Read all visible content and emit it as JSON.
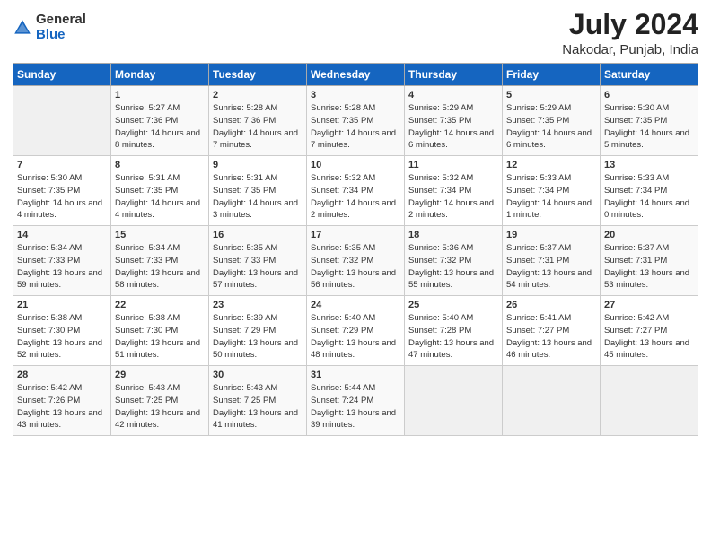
{
  "header": {
    "logo_general": "General",
    "logo_blue": "Blue",
    "title": "July 2024",
    "location": "Nakodar, Punjab, India"
  },
  "calendar": {
    "days_of_week": [
      "Sunday",
      "Monday",
      "Tuesday",
      "Wednesday",
      "Thursday",
      "Friday",
      "Saturday"
    ],
    "weeks": [
      [
        {
          "day": "",
          "sunrise": "",
          "sunset": "",
          "daylight": ""
        },
        {
          "day": "1",
          "sunrise": "Sunrise: 5:27 AM",
          "sunset": "Sunset: 7:36 PM",
          "daylight": "Daylight: 14 hours and 8 minutes."
        },
        {
          "day": "2",
          "sunrise": "Sunrise: 5:28 AM",
          "sunset": "Sunset: 7:36 PM",
          "daylight": "Daylight: 14 hours and 7 minutes."
        },
        {
          "day": "3",
          "sunrise": "Sunrise: 5:28 AM",
          "sunset": "Sunset: 7:35 PM",
          "daylight": "Daylight: 14 hours and 7 minutes."
        },
        {
          "day": "4",
          "sunrise": "Sunrise: 5:29 AM",
          "sunset": "Sunset: 7:35 PM",
          "daylight": "Daylight: 14 hours and 6 minutes."
        },
        {
          "day": "5",
          "sunrise": "Sunrise: 5:29 AM",
          "sunset": "Sunset: 7:35 PM",
          "daylight": "Daylight: 14 hours and 6 minutes."
        },
        {
          "day": "6",
          "sunrise": "Sunrise: 5:30 AM",
          "sunset": "Sunset: 7:35 PM",
          "daylight": "Daylight: 14 hours and 5 minutes."
        }
      ],
      [
        {
          "day": "7",
          "sunrise": "Sunrise: 5:30 AM",
          "sunset": "Sunset: 7:35 PM",
          "daylight": "Daylight: 14 hours and 4 minutes."
        },
        {
          "day": "8",
          "sunrise": "Sunrise: 5:31 AM",
          "sunset": "Sunset: 7:35 PM",
          "daylight": "Daylight: 14 hours and 4 minutes."
        },
        {
          "day": "9",
          "sunrise": "Sunrise: 5:31 AM",
          "sunset": "Sunset: 7:35 PM",
          "daylight": "Daylight: 14 hours and 3 minutes."
        },
        {
          "day": "10",
          "sunrise": "Sunrise: 5:32 AM",
          "sunset": "Sunset: 7:34 PM",
          "daylight": "Daylight: 14 hours and 2 minutes."
        },
        {
          "day": "11",
          "sunrise": "Sunrise: 5:32 AM",
          "sunset": "Sunset: 7:34 PM",
          "daylight": "Daylight: 14 hours and 2 minutes."
        },
        {
          "day": "12",
          "sunrise": "Sunrise: 5:33 AM",
          "sunset": "Sunset: 7:34 PM",
          "daylight": "Daylight: 14 hours and 1 minute."
        },
        {
          "day": "13",
          "sunrise": "Sunrise: 5:33 AM",
          "sunset": "Sunset: 7:34 PM",
          "daylight": "Daylight: 14 hours and 0 minutes."
        }
      ],
      [
        {
          "day": "14",
          "sunrise": "Sunrise: 5:34 AM",
          "sunset": "Sunset: 7:33 PM",
          "daylight": "Daylight: 13 hours and 59 minutes."
        },
        {
          "day": "15",
          "sunrise": "Sunrise: 5:34 AM",
          "sunset": "Sunset: 7:33 PM",
          "daylight": "Daylight: 13 hours and 58 minutes."
        },
        {
          "day": "16",
          "sunrise": "Sunrise: 5:35 AM",
          "sunset": "Sunset: 7:33 PM",
          "daylight": "Daylight: 13 hours and 57 minutes."
        },
        {
          "day": "17",
          "sunrise": "Sunrise: 5:35 AM",
          "sunset": "Sunset: 7:32 PM",
          "daylight": "Daylight: 13 hours and 56 minutes."
        },
        {
          "day": "18",
          "sunrise": "Sunrise: 5:36 AM",
          "sunset": "Sunset: 7:32 PM",
          "daylight": "Daylight: 13 hours and 55 minutes."
        },
        {
          "day": "19",
          "sunrise": "Sunrise: 5:37 AM",
          "sunset": "Sunset: 7:31 PM",
          "daylight": "Daylight: 13 hours and 54 minutes."
        },
        {
          "day": "20",
          "sunrise": "Sunrise: 5:37 AM",
          "sunset": "Sunset: 7:31 PM",
          "daylight": "Daylight: 13 hours and 53 minutes."
        }
      ],
      [
        {
          "day": "21",
          "sunrise": "Sunrise: 5:38 AM",
          "sunset": "Sunset: 7:30 PM",
          "daylight": "Daylight: 13 hours and 52 minutes."
        },
        {
          "day": "22",
          "sunrise": "Sunrise: 5:38 AM",
          "sunset": "Sunset: 7:30 PM",
          "daylight": "Daylight: 13 hours and 51 minutes."
        },
        {
          "day": "23",
          "sunrise": "Sunrise: 5:39 AM",
          "sunset": "Sunset: 7:29 PM",
          "daylight": "Daylight: 13 hours and 50 minutes."
        },
        {
          "day": "24",
          "sunrise": "Sunrise: 5:40 AM",
          "sunset": "Sunset: 7:29 PM",
          "daylight": "Daylight: 13 hours and 48 minutes."
        },
        {
          "day": "25",
          "sunrise": "Sunrise: 5:40 AM",
          "sunset": "Sunset: 7:28 PM",
          "daylight": "Daylight: 13 hours and 47 minutes."
        },
        {
          "day": "26",
          "sunrise": "Sunrise: 5:41 AM",
          "sunset": "Sunset: 7:27 PM",
          "daylight": "Daylight: 13 hours and 46 minutes."
        },
        {
          "day": "27",
          "sunrise": "Sunrise: 5:42 AM",
          "sunset": "Sunset: 7:27 PM",
          "daylight": "Daylight: 13 hours and 45 minutes."
        }
      ],
      [
        {
          "day": "28",
          "sunrise": "Sunrise: 5:42 AM",
          "sunset": "Sunset: 7:26 PM",
          "daylight": "Daylight: 13 hours and 43 minutes."
        },
        {
          "day": "29",
          "sunrise": "Sunrise: 5:43 AM",
          "sunset": "Sunset: 7:25 PM",
          "daylight": "Daylight: 13 hours and 42 minutes."
        },
        {
          "day": "30",
          "sunrise": "Sunrise: 5:43 AM",
          "sunset": "Sunset: 7:25 PM",
          "daylight": "Daylight: 13 hours and 41 minutes."
        },
        {
          "day": "31",
          "sunrise": "Sunrise: 5:44 AM",
          "sunset": "Sunset: 7:24 PM",
          "daylight": "Daylight: 13 hours and 39 minutes."
        },
        {
          "day": "",
          "sunrise": "",
          "sunset": "",
          "daylight": ""
        },
        {
          "day": "",
          "sunrise": "",
          "sunset": "",
          "daylight": ""
        },
        {
          "day": "",
          "sunrise": "",
          "sunset": "",
          "daylight": ""
        }
      ]
    ]
  }
}
